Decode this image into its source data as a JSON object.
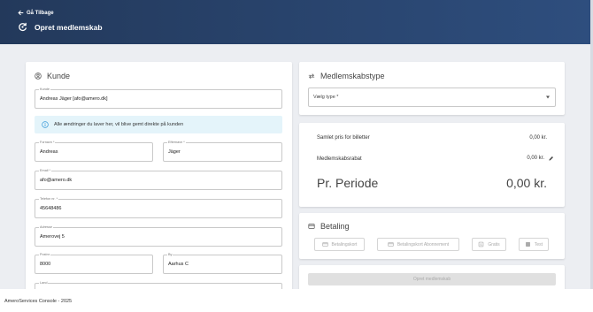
{
  "header": {
    "back_label": "Gå Tilbage",
    "title": "Opret medlemskab"
  },
  "kunde": {
    "title": "Kunde",
    "customer": {
      "label": "Kunde",
      "value": "Andreas Jäger [afo@amero.dk]"
    },
    "info": "Alle ændringer du laver her, vil blive gemt direkte på kunden",
    "fornavn": {
      "label": "Fornavn *",
      "value": "Andreas"
    },
    "efternavn": {
      "label": "Efternavn *",
      "value": "Jäger"
    },
    "email": {
      "label": "Email *",
      "value": "afo@amero.dk"
    },
    "telefon": {
      "label": "Telefon nr. *",
      "value": "45648486"
    },
    "adresse": {
      "label": "Adresse",
      "value": "Amerovej 5"
    },
    "postnr": {
      "label": "Postnr",
      "value": "8000"
    },
    "by": {
      "label": "By",
      "value": "Aarhus C"
    },
    "land": {
      "label": "Land",
      "value": ""
    }
  },
  "medlemskabstype": {
    "title": "Medlemskabstype",
    "select_placeholder": "Vælg type *"
  },
  "summary": {
    "samlet_label": "Samlet pris for billetter",
    "samlet_value": "0,00 kr.",
    "rabat_label": "Medlemskabsrabat",
    "rabat_value": "0,00 kr.",
    "periode_label": "Pr. Periode",
    "periode_value": "0,00 kr."
  },
  "betaling": {
    "title": "Betaling",
    "buttons": [
      "Betalingskort",
      "Betalingskort Abonnement",
      "Gratis",
      "Test"
    ]
  },
  "submit_label": "Opret medlemskab",
  "footer": "AmeroServices Console - 2025",
  "colors": {
    "header": "#2a4670",
    "info_bg": "#e4f4fa",
    "info_icon": "#3a9ad9"
  }
}
